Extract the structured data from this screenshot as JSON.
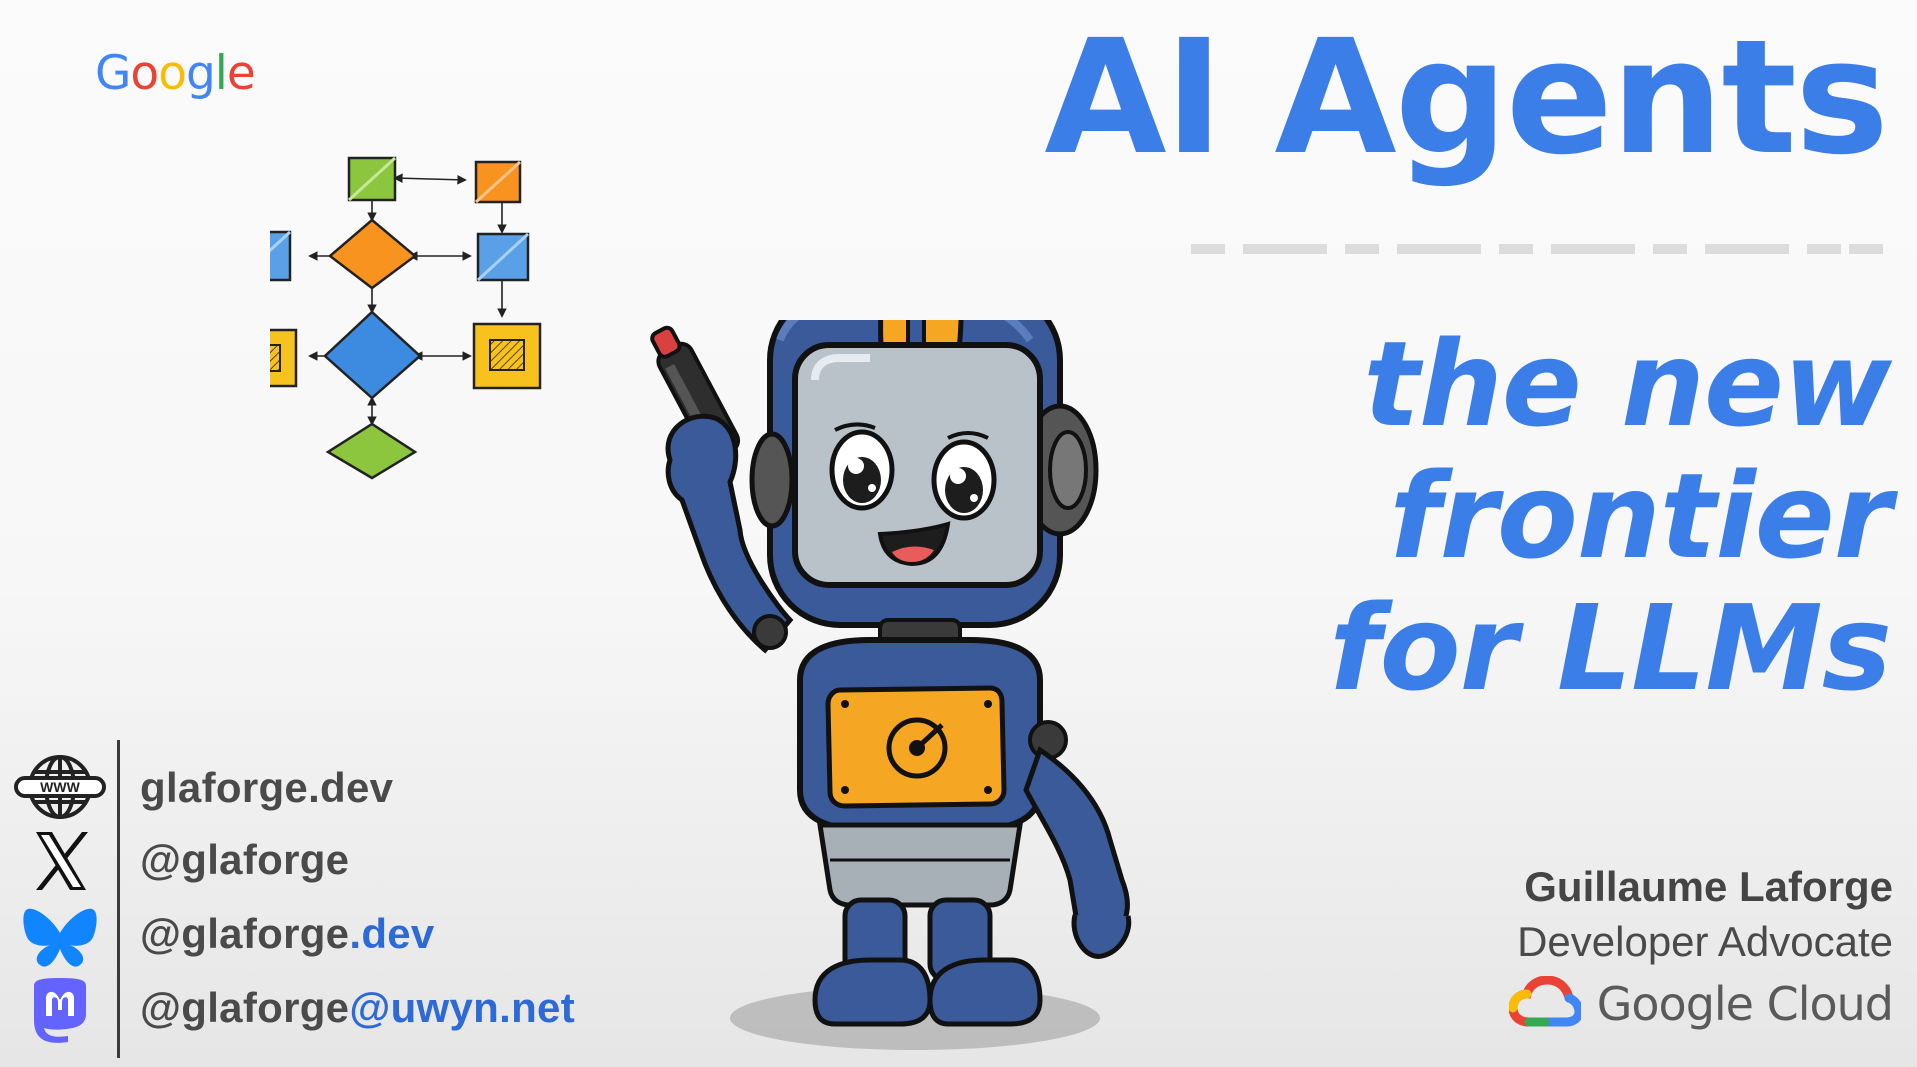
{
  "logo": {
    "letters": [
      "G",
      "o",
      "o",
      "g",
      "l",
      "e"
    ],
    "letter_colors": [
      "#4285F4",
      "#EA4335",
      "#FBBC05",
      "#4285F4",
      "#34A853",
      "#EA4335"
    ]
  },
  "title": {
    "main": "AI Agents",
    "subtitle_lines": [
      "the new",
      "frontier",
      "for LLMs"
    ],
    "accent_color": "#3c7ee8"
  },
  "contact": {
    "website": "glaforge.dev",
    "x_handle": "@glaforge",
    "bluesky_prefix": "@glaforge",
    "bluesky_suffix": ".dev",
    "mastodon_prefix": "@glaforge",
    "mastodon_suffix": "@uwyn.net",
    "icons": [
      "www-globe-icon",
      "x-logo-icon",
      "bluesky-butterfly-icon",
      "mastodon-logo-icon"
    ]
  },
  "speaker": {
    "name": "Guillaume Laforge",
    "role": "Developer Advocate",
    "company": "Google Cloud"
  },
  "colors": {
    "blue": "#3c7ee8",
    "link_blue": "#2d6ad6",
    "robot_blue": "#3a5a9a",
    "robot_orange": "#f5a623"
  },
  "globe_label": "WWW"
}
